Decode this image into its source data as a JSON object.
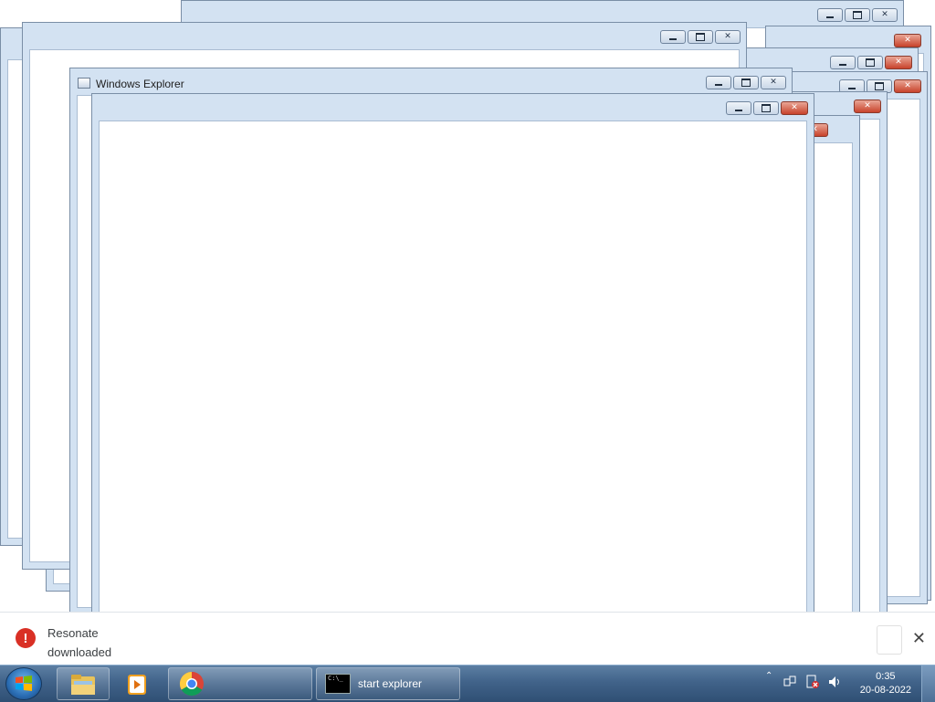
{
  "windows": {
    "explorer_title": "Windows Explorer"
  },
  "notification": {
    "line1": "Resonate",
    "line2": "downloaded",
    "close_glyph": "✕"
  },
  "taskbar": {
    "pinned": [
      "windows-explorer",
      "media-player",
      "chrome"
    ],
    "active_task_label": "start  explorer",
    "time": "0:35",
    "date": "20-08-2022"
  },
  "icons": {
    "alert": "!",
    "close": "✕"
  }
}
